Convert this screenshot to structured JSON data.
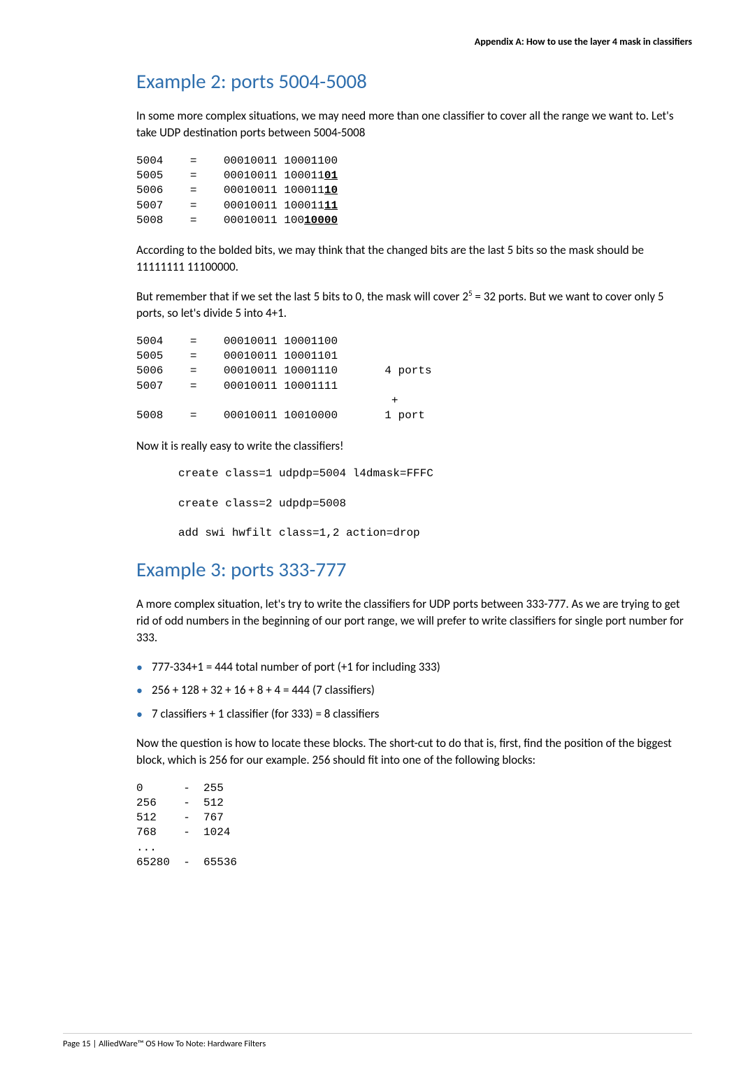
{
  "header": {
    "running_head": "Appendix A: How to use the layer 4 mask in classifiers"
  },
  "section1": {
    "title": "Example 2: ports 5004-5008",
    "p1": "In some more complex situations, we may need more than one classifier to cover all the range we want to. Let's take UDP destination ports between 5004-5008",
    "code1_lines": {
      "l1a": "5004    =    00010011 10001100",
      "l2a": "5005    =    00010011 100011",
      "l2b": "01",
      "l3a": "5006    =    00010011 100011",
      "l3b": "10",
      "l4a": "5007    =    00010011 100011",
      "l4b": "11",
      "l5a": "5008    =    00010011 100",
      "l5b": "10000"
    },
    "p2": "According to the bolded bits, we may think that the changed bits are the last 5 bits so the mask should be 11111111 11100000.",
    "p3a": "But remember that if we set the last 5 bits to 0, the mask will cover 2",
    "p3sup": "5",
    "p3b": " = 32 ports. But we want to cover only 5 ports, so let's divide 5 into 4+1.",
    "code2": "5004    =    00010011 10001100\n5005    =    00010011 10001101\n5006    =    00010011 10001110       4 ports\n5007    =    00010011 10001111\n                                      +\n5008    =    00010011 10010000       1 port",
    "p4": "Now it is really easy to write the classifiers!",
    "code3": "create class=1 udpdp=5004 l4dmask=FFFC\n\ncreate class=2 udpdp=5008\n\nadd swi hwfilt class=1,2 action=drop"
  },
  "section2": {
    "title": "Example 3: ports 333-777",
    "p1": "A more complex situation, let's try to write the classifiers for UDP ports between 333-777. As we are trying to get rid of odd numbers in the beginning of our port range, we will prefer to write classifiers for single port number for 333.",
    "bullets": [
      "777-334+1 = 444 total number of port (+1 for including 333)",
      "256 + 128 + 32 + 16 + 8 + 4 = 444 (7 classifiers)",
      "7 classifiers + 1 classifier (for 333) = 8 classifiers"
    ],
    "p2": "Now the question is how to locate these blocks. The short-cut to do that is, first, find the position of the biggest block, which is 256 for our example. 256 should fit into one of the following blocks:",
    "code1": "0      -  255\n256    -  512\n512    -  767\n768    -  1024\n...\n65280  -  65536"
  },
  "footer": {
    "text": "Page 15 | AlliedWare™ OS How To Note: Hardware Filters"
  }
}
